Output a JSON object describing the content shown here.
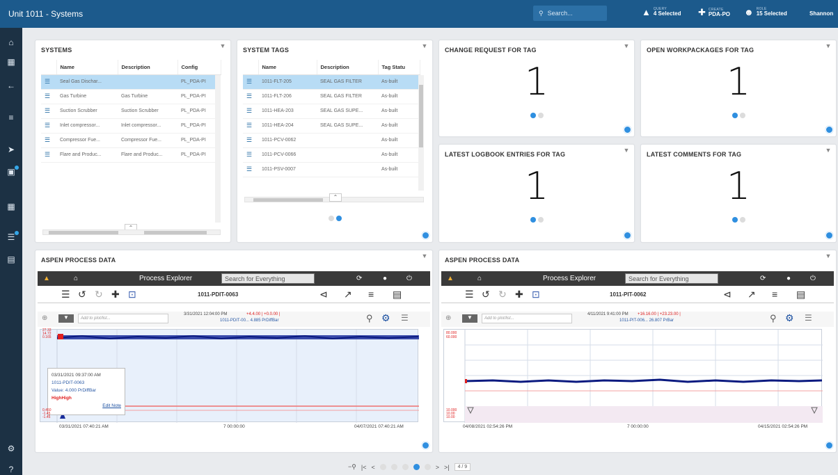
{
  "app": {
    "title": "Unit 1011 - Systems"
  },
  "topbar": {
    "search_placeholder": "Search...",
    "query": {
      "small": "QUERY",
      "value": "4 Selected"
    },
    "create": {
      "small": "CREATE",
      "value": "PDA-PO"
    },
    "role": {
      "small": "ROLE",
      "value": "15 Selected"
    },
    "user": "Shannon"
  },
  "systems": {
    "title": "SYSTEMS",
    "columns": [
      "Name",
      "Description",
      "Config"
    ],
    "rows": [
      [
        "Seal Gas Dischar...",
        "",
        "PL_PDA-PI"
      ],
      [
        "Gas Turbine",
        "Gas Turbine",
        "PL_PDA-PI"
      ],
      [
        "Suction Scrubber",
        "Suction Scrubber",
        "PL_PDA-PI"
      ],
      [
        "Inlet compressor...",
        "Inlet compressor...",
        "PL_PDA-PI"
      ],
      [
        "Compressor Fue...",
        "Compressor Fue...",
        "PL_PDA-PI"
      ],
      [
        "Flare and Produc...",
        "Flare and Produc...",
        "PL_PDA-PI"
      ]
    ]
  },
  "system_tags": {
    "title": "SYSTEM TAGS",
    "columns": [
      "Name",
      "Description",
      "Tag Statu"
    ],
    "rows": [
      [
        "1011-FLT-205",
        "SEAL GAS FILTER",
        "As-built"
      ],
      [
        "1011-FLT-206",
        "SEAL GAS FILTER",
        "As-built"
      ],
      [
        "1011-HEA-203",
        "SEAL GAS SUPE...",
        "As-built"
      ],
      [
        "1011-HEA-204",
        "SEAL GAS SUPE...",
        "As-built"
      ],
      [
        "1011-PCV-0062",
        "",
        "As-built"
      ],
      [
        "1011-PCV-0066",
        "",
        "As-built"
      ],
      [
        "1011-PSV-0007",
        "",
        "As-built"
      ]
    ]
  },
  "change_request": {
    "title": "CHANGE REQUEST FOR TAG",
    "value": "1"
  },
  "open_workpackages": {
    "title": "OPEN WORKPACKAGES FOR TAG",
    "value": "1"
  },
  "latest_logbook": {
    "title": "LATEST LOGBOOK ENTRIES FOR TAG",
    "value": "1"
  },
  "latest_comments": {
    "title": "LATEST COMMENTS FOR TAG",
    "value": "1"
  },
  "aspen_left": {
    "title": "ASPEN PROCESS DATA",
    "pe_title": "Process Explorer",
    "pe_search": "Search for Everything",
    "tag": "1011-PDIT-0063",
    "add_placeholder": "Add to plot/list...",
    "cursor_time": "3/31/2021 12:04:00 PM",
    "cursor_values": "+4.4.00 | +0.0.00 |",
    "cursor_legend": "1011-PDIT-00... 4.885 PrDiffBar",
    "y_ticks_top": [
      "27.33",
      "14.72",
      "0.165"
    ],
    "y_ticks_bottom": [
      "0.450",
      "-1.45",
      "-1.45"
    ],
    "tooltip": {
      "time": "03/31/2021 09:37:00 AM",
      "tag": "1011-PDIT-0063",
      "value": "Value: 4.000 PrDiffBar",
      "status": "HighHigh",
      "link": "Edit Note"
    },
    "x_start": "03/31/2021 07:40:21 AM",
    "x_mid": "7 00:00:00",
    "x_end": "04/07/2021 07:40:21 AM"
  },
  "aspen_right": {
    "title": "ASPEN PROCESS DATA",
    "pe_title": "Process Explorer",
    "pe_search": "Search for Everything",
    "tag": "1011-PIT-0062",
    "add_placeholder": "Add to plot/list...",
    "cursor_time": "4/11/2021 9:41:00 PM",
    "cursor_values": "+16.16.00 | +23.23.00 |",
    "cursor_legend": "1011-PIT-006... 26.807 PrBar",
    "y_ticks_top": [
      "80.000",
      "60.000"
    ],
    "y_ticks_bottom": [
      "10.000",
      "10.00",
      "10.00"
    ],
    "x_start": "04/08/2021 02:54:26 PM",
    "x_mid": "7 00:00:00",
    "x_end": "04/15/2021 02:54:26 PM"
  },
  "footer": {
    "page": "4 / 9"
  },
  "colors": {
    "topbar": "#1c5a8c",
    "sidebar": "#1c3144",
    "accent": "#2f8fe0",
    "selected_row": "#b8dcf5",
    "series": "#1a2e9c",
    "alarm": "#e02020"
  }
}
